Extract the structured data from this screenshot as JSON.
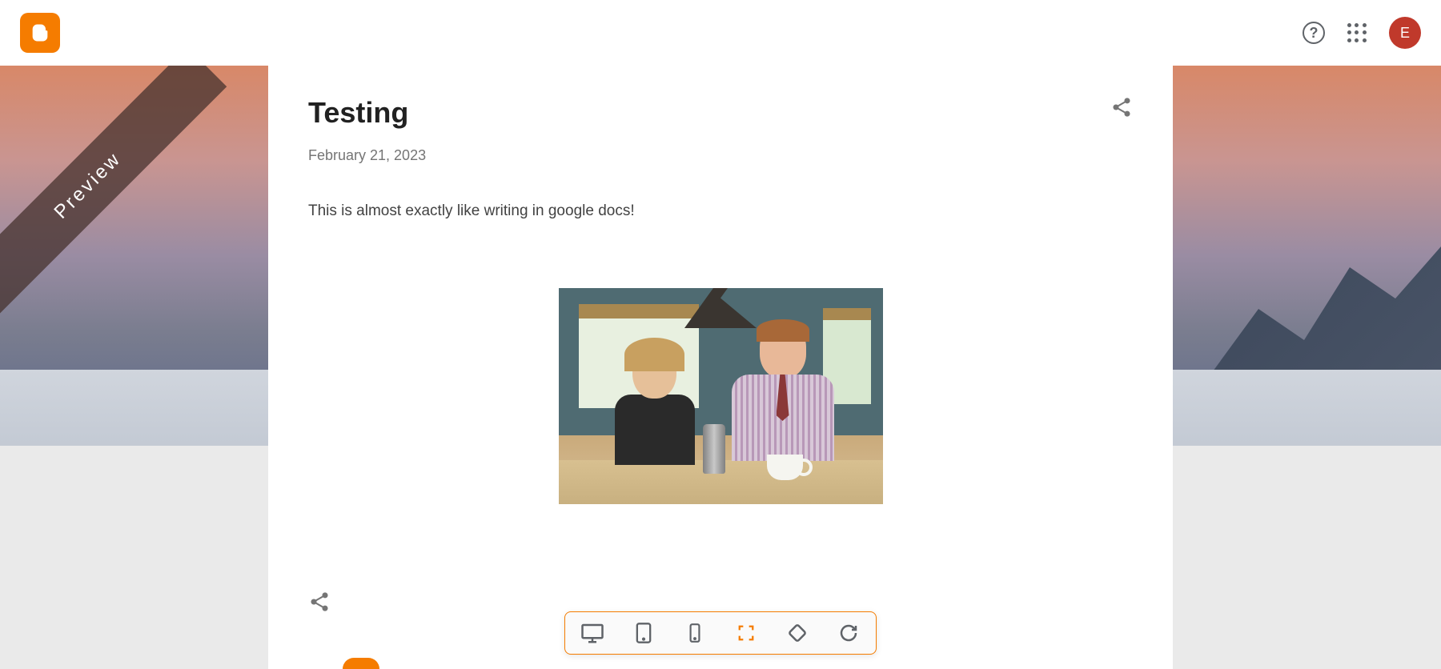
{
  "ribbon": {
    "label": "Preview"
  },
  "header": {
    "avatar_initial": "E"
  },
  "post": {
    "title": "Testing",
    "date": "February 21, 2023",
    "body_text": "This is almost exactly like writing in google docs!"
  },
  "toolbar": {
    "buttons": [
      {
        "name": "desktop",
        "active": false
      },
      {
        "name": "tablet",
        "active": false
      },
      {
        "name": "phone",
        "active": false
      },
      {
        "name": "fullscreen",
        "active": true
      },
      {
        "name": "rotate",
        "active": false
      },
      {
        "name": "refresh",
        "active": false
      }
    ]
  }
}
